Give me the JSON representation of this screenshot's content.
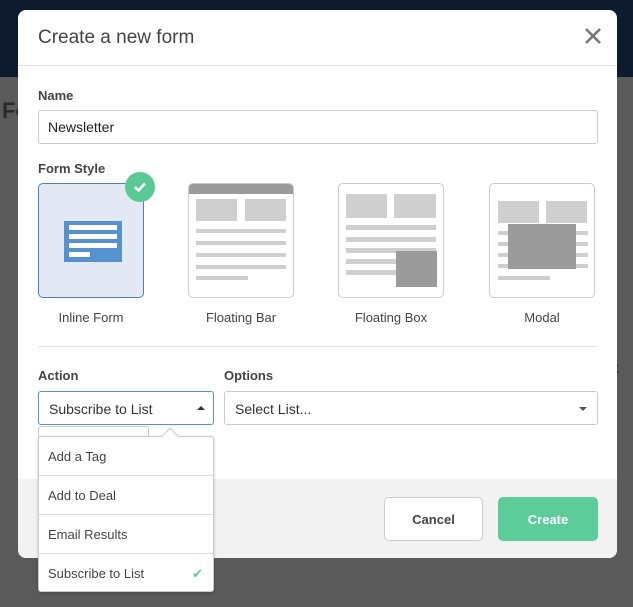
{
  "background": {
    "heading_fragment": "Fo",
    "text_fragment": "t"
  },
  "modal": {
    "title": "Create a new form",
    "name_label": "Name",
    "name_value": "Newsletter",
    "form_style_label": "Form Style",
    "styles": [
      {
        "label": "Inline Form",
        "selected": true
      },
      {
        "label": "Floating Bar",
        "selected": false
      },
      {
        "label": "Floating Box",
        "selected": false
      },
      {
        "label": "Modal",
        "selected": false
      }
    ],
    "action_label": "Action",
    "action_value": "Subscribe to List",
    "options_label": "Options",
    "options_placeholder": "Select List...",
    "action_options": [
      {
        "label": "Add a Tag",
        "selected": false
      },
      {
        "label": "Add to Deal",
        "selected": false
      },
      {
        "label": "Email Results",
        "selected": false
      },
      {
        "label": "Subscribe to List",
        "selected": true
      }
    ],
    "cancel_label": "Cancel",
    "create_label": "Create"
  },
  "colors": {
    "accent_green": "#5bcc9a",
    "selected_blue": "#4e7ec0"
  }
}
